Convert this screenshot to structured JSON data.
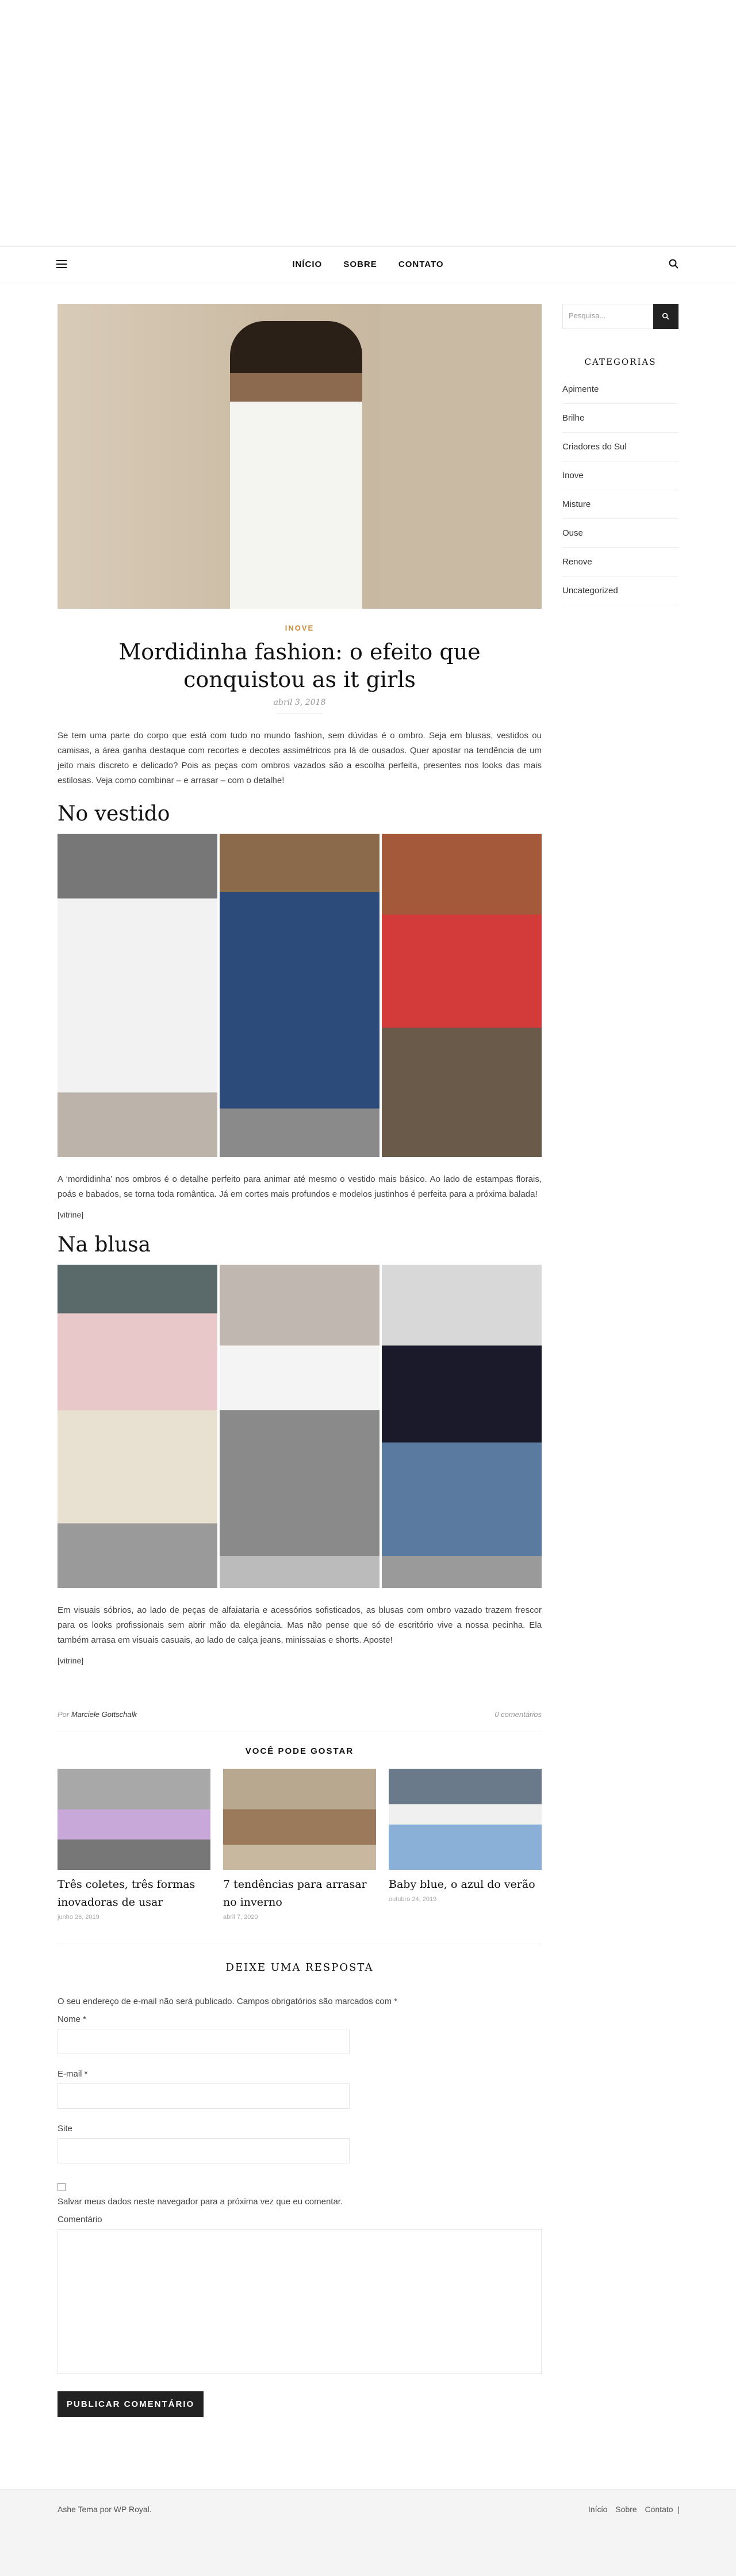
{
  "nav": {
    "items": [
      "INÍCIO",
      "SOBRE",
      "CONTATO"
    ]
  },
  "post": {
    "category": "INOVE",
    "title": "Mordidinha fashion: o efeito que conquistou as it girls",
    "date": "abril 3, 2018",
    "intro": "Se tem uma parte do corpo que está com tudo no mundo fashion, sem dúvidas é o ombro. Seja em blusas, vestidos ou camisas, a área ganha destaque com recortes e decotes assimétricos pra lá de ousados. Quer apostar na tendência de um jeito mais discreto e delicado? Pois as peças com ombros vazados são a escolha perfeita, presentes nos looks das mais estilosas. Veja como combinar – e arrasar – com o detalhe!",
    "section1_title": "No vestido",
    "section1_text": "A ‘mordidinha’ nos ombros é o detalhe perfeito para animar até mesmo o vestido mais básico. Ao lado de estampas florais, poás e babados, se torna toda romântica. Já em cortes mais profundos e modelos justinhos é perfeita para a próxima balada!",
    "section1_vitrine": "[vitrine]",
    "section2_title": "Na blusa",
    "section2_text": "Em visuais sóbrios, ao lado de peças de alfaiataria e acessórios sofisticados, as blusas com ombro vazado trazem frescor para os looks profissionais sem abrir mão da elegância. Mas não pense que só de escritório vive a nossa pecinha. Ela também arrasa em visuais casuais, ao lado de calça jeans, minissaias e shorts. Aposte!",
    "section2_vitrine": "[vitrine]",
    "author_prefix": "Por",
    "author": "Marciele Gottschalk",
    "comments": "0 comentários"
  },
  "related": {
    "heading": "VOCÊ PODE GOSTAR",
    "items": [
      {
        "title": "Três coletes, três formas inovadoras de usar",
        "date": "junho 26, 2019"
      },
      {
        "title": "7 tendências para arrasar no inverno",
        "date": "abril 7, 2020"
      },
      {
        "title": "Baby blue, o azul do verão",
        "date": "outubro 24, 2019"
      }
    ]
  },
  "form": {
    "heading": "DEIXE UMA RESPOSTA",
    "notice": "O seu endereço de e-mail não será publicado. Campos obrigatórios são marcados com *",
    "name_label": "Nome *",
    "email_label": "E-mail *",
    "site_label": "Site",
    "save_label": "Salvar meus dados neste navegador para a próxima vez que eu comentar.",
    "comment_label": "Comentário",
    "submit": "PUBLICAR COMENTÁRIO"
  },
  "sidebar": {
    "search_placeholder": "Pesquisa...",
    "heading": "CATEGORIAS",
    "categories": [
      "Apimente",
      "Brilhe",
      "Criadores do Sul",
      "Inove",
      "Misture",
      "Ouse",
      "Renove",
      "Uncategorized"
    ]
  },
  "footer": {
    "left": "Ashe Tema por WP Royal.",
    "right": [
      "Início",
      "Sobre",
      "Contato"
    ]
  }
}
